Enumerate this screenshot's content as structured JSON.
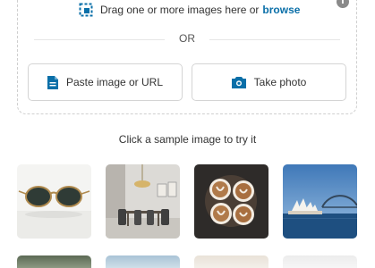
{
  "dropzone": {
    "drag_text": "Drag one or more images here or",
    "browse_label": "browse",
    "info_symbol": "i",
    "or_text": "OR"
  },
  "buttons": {
    "paste_label": "Paste image or URL",
    "photo_label": "Take photo"
  },
  "samples": {
    "title": "Click a sample image to try it",
    "images": [
      "sunglasses",
      "dining-room",
      "latte-art-coffee",
      "sydney-harbour"
    ]
  },
  "icons": [
    "image-select-icon",
    "document-icon",
    "camera-icon",
    "info-icon"
  ],
  "colors": {
    "accent": "#0a6fa8",
    "border": "#d4d4d4",
    "dashed_border": "#cfcfcf"
  }
}
